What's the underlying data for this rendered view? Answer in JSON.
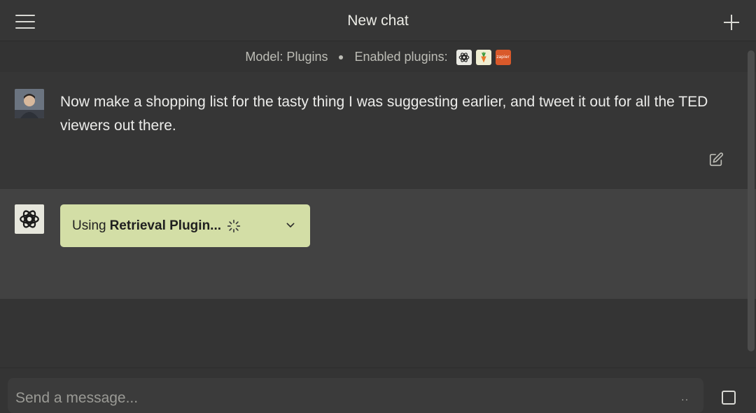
{
  "header": {
    "title": "New chat",
    "menu_icon": "hamburger-menu-icon",
    "new_chat_icon": "plus-icon"
  },
  "model_bar": {
    "model_text": "Model: Plugins",
    "plugins_label": "Enabled plugins:",
    "plugins": [
      {
        "icon": "openai-logo-icon"
      },
      {
        "icon": "carrot-icon"
      },
      {
        "icon": "zapier-logo-icon",
        "text": "zapier"
      }
    ]
  },
  "user_message": {
    "text": "Now make a shopping list for the tasty thing I was suggesting earlier, and tweet it out for all the TED viewers out there.",
    "edit_icon": "edit-icon"
  },
  "assistant_message": {
    "plugin_status": {
      "prefix": "Using",
      "plugin_name": "Retrieval Plugin...",
      "spinner_icon": "loading-spinner-icon",
      "chevron_icon": "chevron-down-icon"
    }
  },
  "composer": {
    "placeholder": "Send a message...",
    "dots": "··"
  },
  "colors": {
    "plugin_pill_bg": "#d3dea6",
    "background": "#343434",
    "assistant_bg": "#424242"
  }
}
